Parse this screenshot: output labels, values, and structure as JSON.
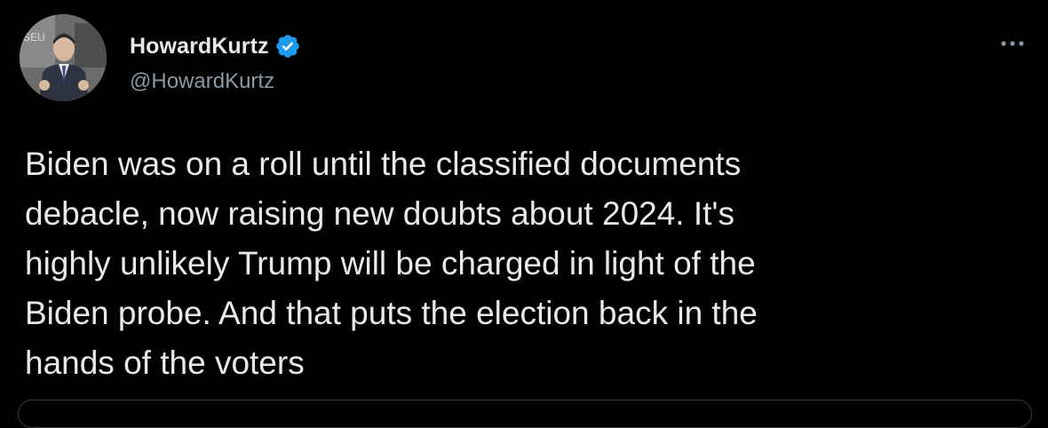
{
  "tweet": {
    "author": {
      "display_name": "HowardKurtz",
      "handle": "@HowardKurtz",
      "verified": true,
      "avatar_icon": "profile-photo"
    },
    "text": "Biden was on a roll until the classified documents\ndebacle, now raising new doubts about 2024. It's\nhighly unlikely Trump will be charged in light of the\nBiden probe. And that puts the election back in the\nhands of the voters",
    "more_icon": "more-horizontal-icon"
  },
  "theme": {
    "background": "#000000",
    "text": "#e7e9ea",
    "secondary_text": "#8b98a5",
    "verified_badge": "#1d9bf0"
  }
}
